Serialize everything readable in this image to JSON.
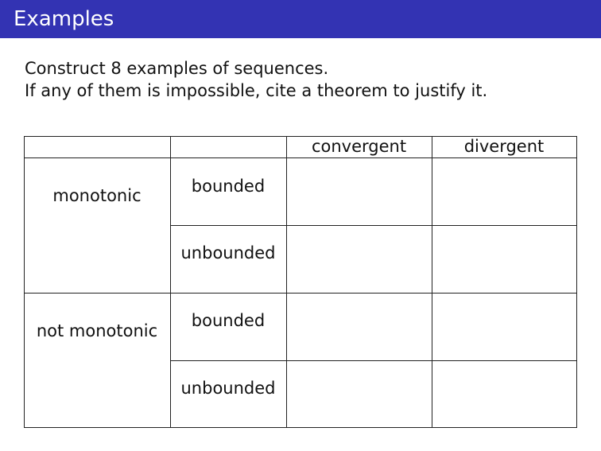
{
  "slide": {
    "title": "Examples",
    "intro": [
      "Construct 8 examples of sequences.",
      "If any of them is impossible, cite a theorem to justify it."
    ]
  },
  "table": {
    "column_headers": [
      "",
      "",
      "convergent",
      "divergent"
    ],
    "groups": [
      {
        "label": "monotonic",
        "rows": [
          "bounded",
          "unbounded"
        ]
      },
      {
        "label": "not monotonic",
        "rows": [
          "bounded",
          "unbounded"
        ]
      }
    ],
    "colors": {
      "border": "#222222",
      "title_bar": "#3333b3"
    }
  }
}
